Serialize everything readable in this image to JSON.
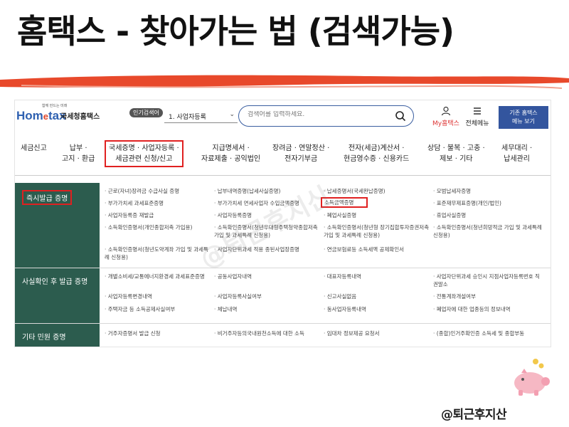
{
  "headline": "홈택스 - 찾아가는 법 (검색가능)",
  "header": {
    "logo_small": "함께 만드는 미래",
    "logo_hom": "Hom",
    "logo_e": "e",
    "logo_tax": "tax",
    "logo_sub": "국세청홈택스",
    "popular_label": "인기검색어",
    "popular_value": "1. 사업자등록",
    "search_placeholder": "검색어를 입력하세요.",
    "my_label": "My홈택스",
    "allmenu_label": "전체메뉴",
    "basic_btn_line1": "기존 홈택스",
    "basic_btn_line2": "메뉴 보기"
  },
  "nav": [
    {
      "lines": [
        "세금신고"
      ]
    },
    {
      "lines": [
        "납부 ·",
        "고지 · 환급"
      ]
    },
    {
      "lines": [
        "국세증명 · 사업자등록 ·",
        "세금관련 신청/신고"
      ],
      "highlight": true
    },
    {
      "lines": [
        "지급명세서 ·",
        "자료제출 · 공익법인"
      ]
    },
    {
      "lines": [
        "장려금 · 연말정산 ·",
        "전자기부금"
      ]
    },
    {
      "lines": [
        "전자(세금)계산서 ·",
        "현금영수증 · 신용카드"
      ]
    },
    {
      "lines": [
        "상담 · 불복 · 고충 ·",
        "제보 · 기타"
      ]
    },
    {
      "lines": [
        "세무대리 ·",
        "납세관리"
      ]
    }
  ],
  "sections": [
    {
      "title": "즉시발급 증명",
      "columns": [
        [
          "근로(자녀)장려금 수급사실 증명",
          "부가가치세 과세표준증명",
          "사업자등록증 재발급",
          "소득확인증명서(개인종합저축 가입용)",
          "소득확인증명서(청년도약계좌 가입 및 과세특례 신청용)"
        ],
        [
          "납부내역증명(납세사실증명)",
          "부가가치세 면세사업자 수입금액증명",
          "사업자등록증명",
          "소득확인증명서(청년우대형주택청약종합저축 가입 및 과세특례 신청용)",
          "사업자단위과세 적용 종된사업장증명"
        ],
        [
          "납세증명서(국세완납증명)",
          "소득금액증명",
          "폐업사실증명",
          "소득확인증명서(청년형 장기집합투자증권저축 가입 및 과세특례 신청용)",
          "연금보험료등 소득세액 공제확인서"
        ],
        [
          "모범납세자증명",
          "표준재무제표증명(개인/법인)",
          "휴업사실증명",
          "소득확인증명서(청년희망적금 가입 및 과세특례 신청용)"
        ]
      ],
      "highlight": "소득금액증명"
    },
    {
      "title": "사실확인 후 발급 증명",
      "columns": [
        [
          "개별소비세/교통에너지환경세 과세표준증명",
          "사업자등록변경내역",
          "주택자금 등 소득공제사실여부"
        ],
        [
          "공동사업자내역",
          "사업자등록사실여부",
          "체납내역"
        ],
        [
          "대표자등록내역",
          "신고사실없음",
          "동사업자등록내역"
        ],
        [
          "사업자단위과세 승인시 지점사업자등록번호 직권말소",
          "전통계좌개설여부",
          "폐업자에 대한 업종등의 정보내역"
        ]
      ]
    },
    {
      "title": "기타 민원 증명",
      "columns": [
        [
          "거주자증명서 발급 신청"
        ],
        [
          "비거주자등의국내원천소득에 대한 소득"
        ],
        [
          "임대차 정보제공 요청서"
        ],
        [
          "(종합)인거주확인증 소득세 및 종합부동"
        ]
      ]
    }
  ],
  "watermark": "@퇴근후지산",
  "footer_tag": "@퇴근후지산"
}
